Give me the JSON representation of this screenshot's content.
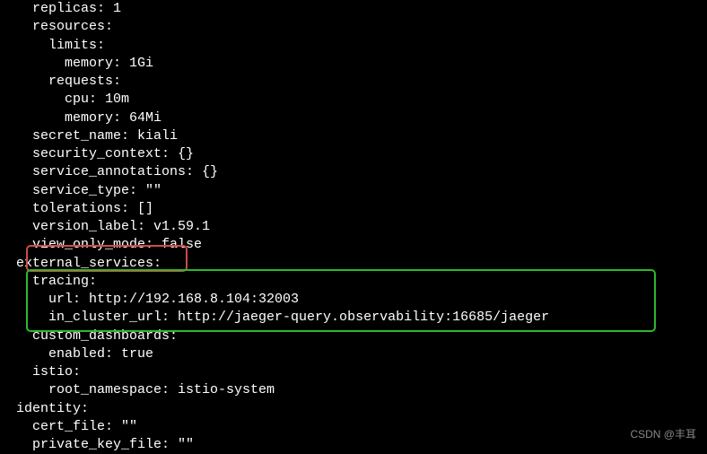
{
  "lines": [
    "    replicas: 1",
    "    resources:",
    "      limits:",
    "        memory: 1Gi",
    "      requests:",
    "        cpu: 10m",
    "        memory: 64Mi",
    "    secret_name: kiali",
    "    security_context: {}",
    "    service_annotations: {}",
    "    service_type: \"\"",
    "    tolerations: []",
    "    version_label: v1.59.1",
    "    view_only_mode: false",
    "  external_services:",
    "    tracing:",
    "      url: http://192.168.8.104:32003",
    "      in_cluster_url: http://jaeger-query.observability:16685/jaeger",
    "    custom_dashboards:",
    "      enabled: true",
    "    istio:",
    "      root_namespace: istio-system",
    "  identity:",
    "    cert_file: \"\"",
    "    private_key_file: \"\""
  ],
  "watermark": "CSDN @丰耳",
  "highlights": {
    "red_box_target": "external_services:",
    "green_box_target": "tracing section (url, in_cluster_url)"
  }
}
